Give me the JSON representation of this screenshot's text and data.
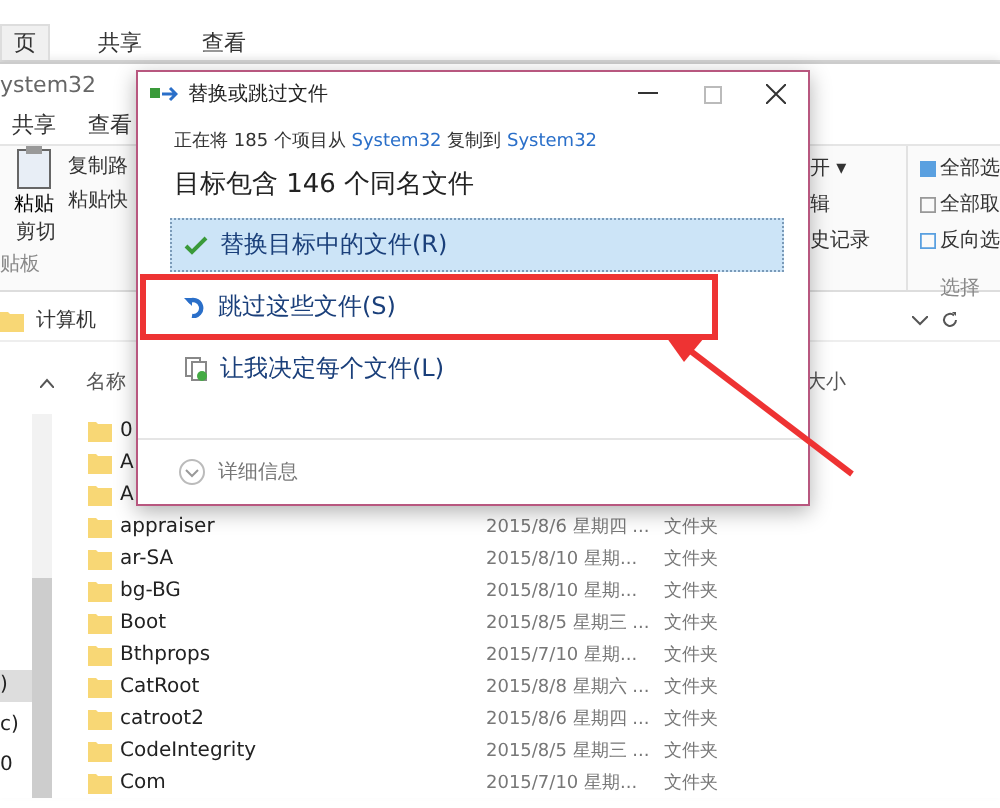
{
  "explorer_back": {
    "tabs": [
      {
        "label": "页",
        "selected": true
      },
      {
        "label": "共享",
        "selected": false
      },
      {
        "label": "查看",
        "selected": false
      }
    ]
  },
  "explorer": {
    "title": "ystem32",
    "tabs": [
      {
        "label": "共享",
        "selected": false
      },
      {
        "label": "查看",
        "selected": false
      }
    ],
    "clipboard": {
      "paste": "粘贴",
      "copy_path": "复制路",
      "paste_shortcut": "粘贴快",
      "cut": "剪切",
      "group": "贴板"
    },
    "open_group": {
      "open": "开 ▾",
      "edit": "辑",
      "history": "史记录"
    },
    "select_group": {
      "select_all": "全部选",
      "select_none": "全部取",
      "invert": "反向选",
      "group": "选择"
    },
    "address": {
      "crumbs": [
        "计算机"
      ]
    },
    "columns": {
      "name": "名称",
      "size": "大小"
    },
    "nav_items": [
      {
        "label": ")",
        "selected": true
      },
      {
        "label": "c)",
        "selected": false
      },
      {
        "label": "0",
        "selected": false
      }
    ],
    "rows": [
      {
        "name": "0"
      },
      {
        "name": "A"
      },
      {
        "name": "A"
      },
      {
        "name": "appraiser",
        "date": "2015/8/6 星期四 ...",
        "type": "文件夹"
      },
      {
        "name": "ar-SA",
        "date": "2015/8/10 星期...",
        "type": "文件夹"
      },
      {
        "name": "bg-BG",
        "date": "2015/8/10 星期...",
        "type": "文件夹"
      },
      {
        "name": "Boot",
        "date": "2015/8/5 星期三 ...",
        "type": "文件夹"
      },
      {
        "name": "Bthprops",
        "date": "2015/7/10 星期...",
        "type": "文件夹"
      },
      {
        "name": "CatRoot",
        "date": "2015/8/8 星期六 ...",
        "type": "文件夹"
      },
      {
        "name": "catroot2",
        "date": "2015/8/6 星期四 ...",
        "type": "文件夹"
      },
      {
        "name": "CodeIntegrity",
        "date": "2015/8/5 星期三 ...",
        "type": "文件夹"
      },
      {
        "name": "Com",
        "date": "2015/7/10 星期...",
        "type": "文件夹"
      }
    ]
  },
  "dialog": {
    "title": "替换或跳过文件",
    "status": [
      {
        "kind": "plain",
        "text": "正在将 185 个项目从 "
      },
      {
        "kind": "link",
        "text": "System32"
      },
      {
        "kind": "plain",
        "text": " 复制到 "
      },
      {
        "kind": "link",
        "text": "System32"
      }
    ],
    "heading": "目标包含 146 个同名文件",
    "options": [
      {
        "kind": "replace",
        "label": "替换目标中的文件(R)",
        "selected": true,
        "highlighted": false
      },
      {
        "kind": "skip",
        "label": "跳过这些文件(S)",
        "selected": false,
        "highlighted": true
      },
      {
        "kind": "decide",
        "label": "让我决定每个文件(L)",
        "selected": false,
        "highlighted": false
      }
    ],
    "details": "详细信息"
  }
}
